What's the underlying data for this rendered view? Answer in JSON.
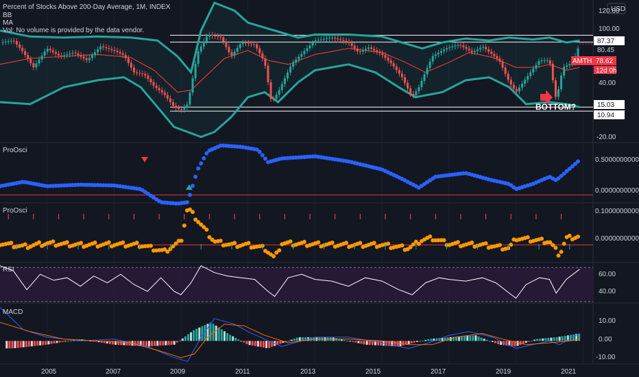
{
  "header": {
    "title": "Percent of Stocks Above 200-Day Average, 1M, INDEX",
    "legend_bb": "BB",
    "legend_ma": "MA",
    "legend_vol": "Vol: No volume is provided by the data vendor.",
    "currency": "USD"
  },
  "annotation": {
    "bottom_text": "BOTTOM?"
  },
  "colors": {
    "bg": "#131722",
    "grid": "#1e2230",
    "up": "#26a69a",
    "down": "#ef5350",
    "bb": "#26a69a",
    "ma": "#e53935",
    "proosci1": "#2962ff",
    "proosci2": "#ff9800",
    "rsi": "#ffffff",
    "rsi_band": "#2a1a3c",
    "macd": "#2962ff",
    "signal": "#ff6d00",
    "tag_red": "#f23645",
    "tag_white": "#ffffff"
  },
  "x_axis": {
    "labels": [
      "2005",
      "2007",
      "2009",
      "2011",
      "2013",
      "2015",
      "2017",
      "2019",
      "2021"
    ]
  },
  "price_tags": {
    "t8737": "87.37",
    "t8045": "80.45",
    "amth": "AMTH",
    "t7862": "78.62",
    "countdown": "12d 0h",
    "t1503": "15.03",
    "t1094": "10.94"
  },
  "panes": [
    {
      "name": "price",
      "ticks": [
        "120.00",
        "100.00",
        "40.00",
        "-20.00"
      ],
      "tick_values": [
        120,
        100,
        40,
        -20
      ]
    },
    {
      "name": "proosci-1",
      "label": "ProOsci",
      "ticks": [
        "0.5000000000",
        "0.0000000000"
      ],
      "tick_values": [
        0.5,
        0
      ]
    },
    {
      "name": "proosci-2",
      "label": "ProOsci",
      "ticks": [
        "0.1000000000",
        "0.0000000000"
      ],
      "tick_values": [
        0.1,
        0
      ]
    },
    {
      "name": "rsi",
      "label": "RSI",
      "ticks": [
        "60.00",
        "40.00"
      ],
      "tick_values": [
        60,
        40
      ]
    },
    {
      "name": "macd",
      "label": "MACD",
      "ticks": [
        "10.00",
        "0.00",
        "-10.00"
      ],
      "tick_values": [
        10,
        0,
        -10
      ]
    }
  ],
  "chart_data": {
    "type": "line",
    "title": "Percent of Stocks Above 200-Day Average, 1M, INDEX",
    "x_domain": [
      2003.6,
      2021.3
    ],
    "price": {
      "x": [
        2003.6,
        2004.0,
        2004.3,
        2004.6,
        2005.0,
        2005.4,
        2005.8,
        2006.2,
        2006.6,
        2007.0,
        2007.3,
        2007.6,
        2007.9,
        2008.2,
        2008.5,
        2008.8,
        2009.0,
        2009.2,
        2009.5,
        2009.8,
        2010.2,
        2010.5,
        2010.8,
        2011.2,
        2011.5,
        2011.7,
        2011.9,
        2012.3,
        2012.7,
        2013.0,
        2013.5,
        2014.0,
        2014.3,
        2014.6,
        2015.0,
        2015.3,
        2015.6,
        2015.9,
        2016.1,
        2016.5,
        2016.9,
        2017.3,
        2017.7,
        2018.0,
        2018.5,
        2018.8,
        2019.0,
        2019.3,
        2019.7,
        2020.0,
        2020.2,
        2020.4,
        2020.7,
        2020.9
      ],
      "y": [
        80,
        82,
        70,
        55,
        74,
        66,
        70,
        62,
        76,
        72,
        67,
        50,
        48,
        36,
        28,
        15,
        12,
        18,
        70,
        88,
        85,
        66,
        80,
        78,
        60,
        20,
        30,
        58,
        72,
        82,
        85,
        80,
        70,
        75,
        68,
        58,
        45,
        25,
        35,
        66,
        74,
        78,
        70,
        76,
        62,
        40,
        30,
        44,
        62,
        62,
        22,
        55,
        60,
        78.62
      ]
    },
    "bb_upper": {
      "x": [
        2003.6,
        2004.5,
        2005.5,
        2006.5,
        2007.5,
        2008.3,
        2008.9,
        2009.3,
        2009.6,
        2010.0,
        2010.6,
        2011.0,
        2011.5,
        2012.0,
        2012.5,
        2013.0,
        2014.0,
        2015.0,
        2015.6,
        2016.2,
        2016.8,
        2017.5,
        2018.2,
        2018.8,
        2019.5,
        2020.0,
        2020.5,
        2020.9
      ],
      "y": [
        92,
        86,
        85,
        86,
        85,
        82,
        66,
        50,
        92,
        120,
        112,
        100,
        95,
        90,
        85,
        88,
        88,
        86,
        80,
        74,
        80,
        84,
        82,
        85,
        83,
        85,
        80,
        82
      ]
    },
    "bb_lower": {
      "x": [
        2003.6,
        2004.5,
        2005.5,
        2006.5,
        2007.3,
        2007.8,
        2008.3,
        2008.8,
        2009.2,
        2009.6,
        2010.0,
        2010.5,
        2011.0,
        2011.5,
        2011.9,
        2012.5,
        2013.0,
        2014.0,
        2014.8,
        2015.5,
        2016.0,
        2016.8,
        2017.5,
        2018.2,
        2018.8,
        2019.3,
        2020.0,
        2020.5,
        2020.9
      ],
      "y": [
        20,
        18,
        35,
        42,
        45,
        35,
        15,
        -5,
        -10,
        -15,
        -10,
        5,
        25,
        30,
        20,
        40,
        52,
        58,
        50,
        35,
        25,
        30,
        42,
        45,
        35,
        18,
        20,
        18,
        15
      ]
    },
    "ma": {
      "x": [
        2003.6,
        2004.5,
        2005.5,
        2006.5,
        2007.5,
        2008.2,
        2008.9,
        2009.3,
        2009.8,
        2010.3,
        2011.0,
        2011.6,
        2012.2,
        2013.0,
        2014.0,
        2015.0,
        2015.7,
        2016.3,
        2017.0,
        2017.6,
        2018.3,
        2019.0,
        2019.6,
        2020.0,
        2020.5,
        2020.9
      ],
      "y": [
        58,
        64,
        66,
        68,
        65,
        52,
        30,
        32,
        48,
        64,
        72,
        62,
        58,
        68,
        74,
        70,
        60,
        50,
        60,
        70,
        65,
        55,
        55,
        58,
        52,
        55
      ]
    },
    "proosci_1": {
      "x": [
        2003.6,
        2004.3,
        2005.0,
        2006.0,
        2007.0,
        2007.8,
        2008.4,
        2008.9,
        2009.2,
        2009.5,
        2009.8,
        2010.2,
        2010.8,
        2011.3,
        2011.6,
        2012.0,
        2013.0,
        2014.0,
        2015.0,
        2015.6,
        2016.1,
        2016.6,
        2017.5,
        2018.3,
        2018.8,
        2019.0,
        2019.5,
        2020.0,
        2020.2,
        2020.5,
        2020.9
      ],
      "y": [
        0.12,
        0.18,
        0.12,
        0.14,
        0.13,
        0.08,
        -0.1,
        -0.12,
        -0.1,
        0.35,
        0.6,
        0.68,
        0.66,
        0.62,
        0.45,
        0.5,
        0.53,
        0.46,
        0.35,
        0.22,
        0.1,
        0.25,
        0.3,
        0.2,
        0.15,
        0.08,
        0.15,
        0.25,
        0.2,
        0.32,
        0.48
      ]
    },
    "proosci_2": {
      "x": [
        2003.6,
        2004.3,
        2005.0,
        2006.0,
        2007.0,
        2007.8,
        2008.5,
        2009.0,
        2009.2,
        2009.6,
        2010.0,
        2010.5,
        2011.0,
        2011.5,
        2011.8,
        2012.0,
        2013.0,
        2014.0,
        2015.0,
        2015.8,
        2016.2,
        2016.5,
        2017.0,
        2018.0,
        2018.8,
        2019.0,
        2019.5,
        2020.0,
        2020.3,
        2020.5,
        2020.9
      ],
      "y": [
        0.005,
        -0.005,
        0.005,
        0.0,
        0.002,
        0.0,
        -0.02,
        0.01,
        0.11,
        0.06,
        0.01,
        0.0,
        0.0,
        -0.01,
        -0.04,
        0.005,
        0.002,
        0.0,
        0.0,
        -0.01,
        0.015,
        0.02,
        0.003,
        0.0,
        -0.01,
        0.02,
        0.015,
        0.01,
        -0.03,
        0.02,
        0.025
      ]
    },
    "rsi": {
      "x": [
        2003.6,
        2004.0,
        2004.4,
        2004.8,
        2005.2,
        2005.6,
        2006.0,
        2006.4,
        2006.8,
        2007.2,
        2007.6,
        2008.0,
        2008.4,
        2008.8,
        2009.0,
        2009.3,
        2009.6,
        2010.0,
        2010.4,
        2010.8,
        2011.2,
        2011.6,
        2011.8,
        2012.2,
        2012.6,
        2013.0,
        2013.5,
        2014.0,
        2014.5,
        2015.0,
        2015.5,
        2015.9,
        2016.3,
        2016.7,
        2017.0,
        2017.5,
        2018.0,
        2018.4,
        2018.8,
        2019.0,
        2019.3,
        2019.7,
        2020.0,
        2020.2,
        2020.5,
        2020.9
      ],
      "y": [
        72,
        66,
        44,
        62,
        55,
        58,
        48,
        60,
        52,
        62,
        50,
        42,
        58,
        42,
        38,
        52,
        72,
        64,
        60,
        58,
        56,
        42,
        36,
        58,
        62,
        56,
        54,
        48,
        58,
        54,
        44,
        38,
        52,
        58,
        56,
        54,
        58,
        52,
        40,
        34,
        50,
        58,
        56,
        40,
        56,
        68
      ]
    },
    "macd": {
      "x": [
        2003.6,
        2004.3,
        2005.0,
        2006.0,
        2007.0,
        2008.0,
        2008.8,
        2009.2,
        2009.6,
        2010.0,
        2010.6,
        2011.0,
        2011.5,
        2012.0,
        2013.0,
        2014.0,
        2015.0,
        2015.8,
        2016.4,
        2017.0,
        2017.6,
        2018.3,
        2019.0,
        2019.5,
        2020.0,
        2020.3,
        2020.9
      ],
      "y": [
        18,
        6,
        2,
        0,
        1,
        -3,
        -9,
        -11,
        2,
        12,
        9,
        5,
        1,
        -3,
        2,
        2,
        -1,
        -4,
        -1,
        3,
        5,
        2,
        -4,
        -2,
        0,
        -2,
        4
      ]
    },
    "signal": {
      "x": [
        2003.6,
        2004.5,
        2005.5,
        2006.5,
        2007.5,
        2008.3,
        2009.0,
        2009.4,
        2009.8,
        2010.3,
        2010.9,
        2011.5,
        2012.2,
        2013.0,
        2014.0,
        2015.0,
        2015.8,
        2016.5,
        2017.2,
        2018.0,
        2018.6,
        2019.3,
        2020.0,
        2020.6,
        2020.9
      ],
      "y": [
        10,
        5,
        1,
        0,
        -1,
        -5,
        -9,
        -7,
        2,
        9,
        8,
        3,
        -1,
        1,
        1,
        0,
        -2,
        -2,
        2,
        4,
        1,
        -2,
        -1,
        0,
        1
      ]
    },
    "macd_hist": {
      "x": [
        2004.0,
        2005.0,
        2006.0,
        2007.0,
        2008.0,
        2008.8,
        2009.4,
        2009.9,
        2010.4,
        2011.0,
        2011.6,
        2012.5,
        2013.5,
        2014.5,
        2015.5,
        2016.4,
        2017.0,
        2017.8,
        2018.5,
        2019.0,
        2019.6,
        2020.2,
        2020.9
      ],
      "y": [
        -4,
        -2,
        1,
        -2,
        -3,
        -2,
        6,
        10,
        4,
        -2,
        -4,
        2,
        2,
        -2,
        -3,
        1,
        2,
        3,
        -2,
        -3,
        1,
        2,
        4
      ]
    },
    "tagged_levels": [
      87.37,
      80.45,
      15.03,
      10.94
    ],
    "last_value": 78.62
  }
}
